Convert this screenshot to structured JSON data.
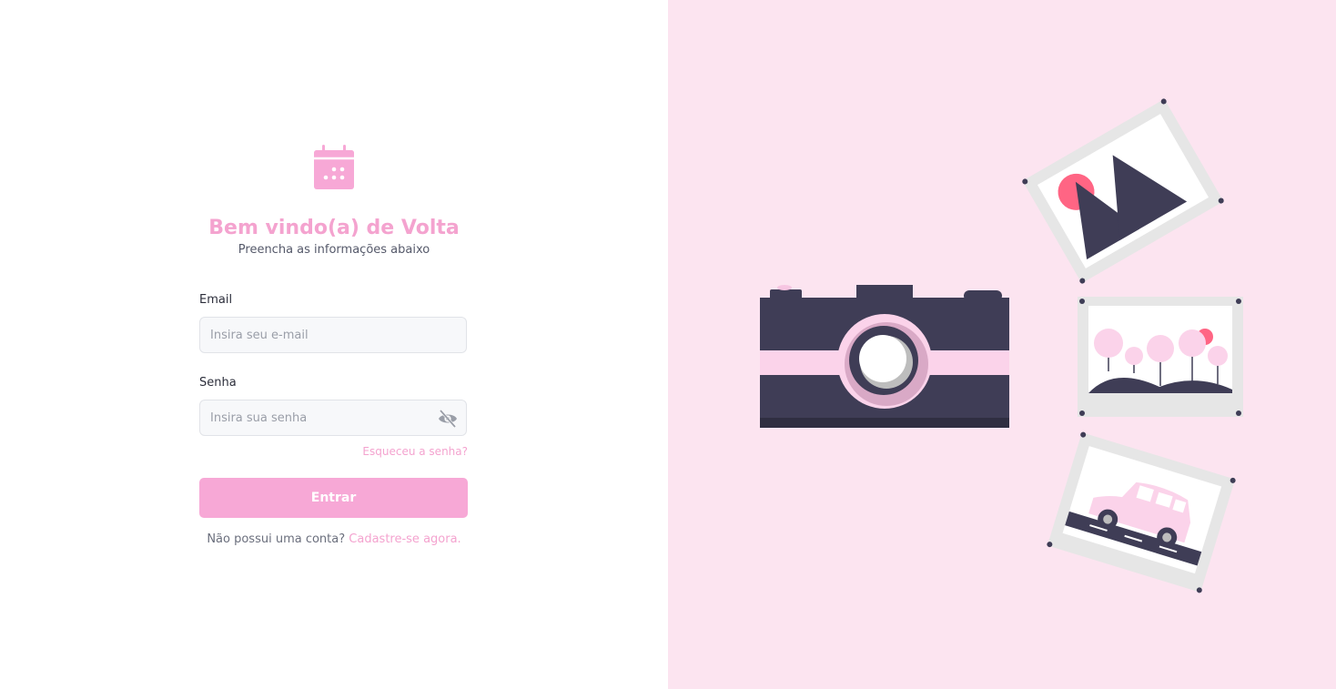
{
  "header": {
    "title": "Bem vindo(a) de Volta",
    "subtitle": "Preencha as informações abaixo"
  },
  "form": {
    "email_label": "Email",
    "email_placeholder": "Insira seu e-mail",
    "password_label": "Senha",
    "password_placeholder": "Insira sua senha",
    "forgot_link": "Esqueceu a senha?",
    "submit_label": "Entrar",
    "signup_prompt": "Não possui uma conta?",
    "signup_link": "Cadastre-se agora."
  },
  "icons": {
    "logo": "calendar-icon",
    "password_toggle": "eye-off-icon"
  },
  "colors": {
    "accent": "#f4a3cf",
    "button": "#f7a8d6",
    "illustration_bg": "#fce4f0",
    "dark": "#3f3d56"
  }
}
